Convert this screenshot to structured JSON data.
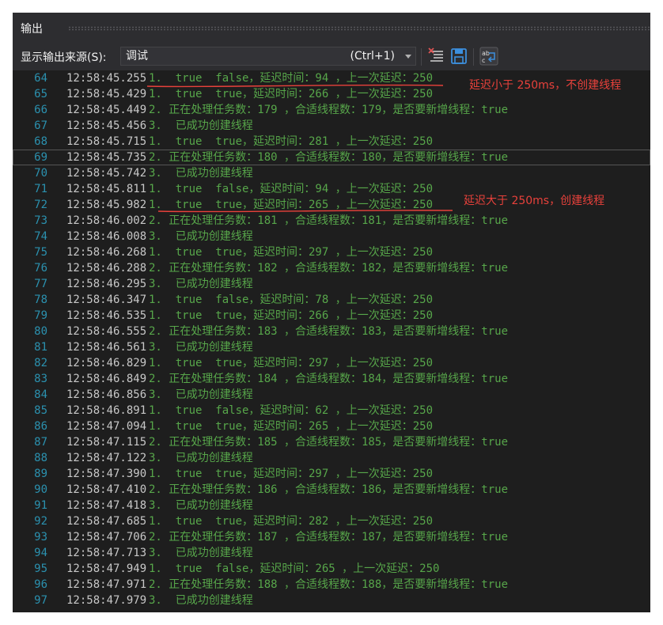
{
  "window": {
    "title": "输出",
    "toolbar": {
      "source_label": "显示输出来源(S):",
      "source_value": "调试",
      "source_hint": "(Ctrl+1)"
    }
  },
  "rows": [
    {
      "ln": "64",
      "ts": "12:58:45.255",
      "msg": "1.  true  false，延迟时间：94 ，上一次延迟：250"
    },
    {
      "ln": "65",
      "ts": "12:58:45.429",
      "msg": "1.  true  true，延迟时间：266 ，上一次延迟：250"
    },
    {
      "ln": "66",
      "ts": "12:58:45.449",
      "msg": "2. 正在处理任务数：179 ，合适线程数：179，是否要新增线程：true"
    },
    {
      "ln": "67",
      "ts": "12:58:45.456",
      "msg": "3.  已成功创建线程"
    },
    {
      "ln": "68",
      "ts": "12:58:45.715",
      "msg": "1.  true  true，延迟时间：281 ，上一次延迟：250"
    },
    {
      "ln": "69",
      "ts": "12:58:45.735",
      "msg": "2. 正在处理任务数：180 ，合适线程数：180，是否要新增线程：true"
    },
    {
      "ln": "70",
      "ts": "12:58:45.742",
      "msg": "3.  已成功创建线程"
    },
    {
      "ln": "71",
      "ts": "12:58:45.811",
      "msg": "1.  true  false，延迟时间：94 ，上一次延迟：250"
    },
    {
      "ln": "72",
      "ts": "12:58:45.982",
      "msg": "1.  true  true，延迟时间：265 ，上一次延迟：250"
    },
    {
      "ln": "73",
      "ts": "12:58:46.002",
      "msg": "2. 正在处理任务数：181 ，合适线程数：181，是否要新增线程：true"
    },
    {
      "ln": "74",
      "ts": "12:58:46.008",
      "msg": "3.  已成功创建线程"
    },
    {
      "ln": "75",
      "ts": "12:58:46.268",
      "msg": "1.  true  true，延迟时间：297 ，上一次延迟：250"
    },
    {
      "ln": "76",
      "ts": "12:58:46.288",
      "msg": "2. 正在处理任务数：182 ，合适线程数：182，是否要新增线程：true"
    },
    {
      "ln": "77",
      "ts": "12:58:46.295",
      "msg": "3.  已成功创建线程"
    },
    {
      "ln": "78",
      "ts": "12:58:46.347",
      "msg": "1.  true  false，延迟时间：78 ，上一次延迟：250"
    },
    {
      "ln": "79",
      "ts": "12:58:46.535",
      "msg": "1.  true  true，延迟时间：266 ，上一次延迟：250"
    },
    {
      "ln": "80",
      "ts": "12:58:46.555",
      "msg": "2. 正在处理任务数：183 ，合适线程数：183，是否要新增线程：true"
    },
    {
      "ln": "81",
      "ts": "12:58:46.561",
      "msg": "3.  已成功创建线程"
    },
    {
      "ln": "82",
      "ts": "12:58:46.829",
      "msg": "1.  true  true，延迟时间：297 ，上一次延迟：250"
    },
    {
      "ln": "83",
      "ts": "12:58:46.849",
      "msg": "2. 正在处理任务数：184 ，合适线程数：184，是否要新增线程：true"
    },
    {
      "ln": "84",
      "ts": "12:58:46.856",
      "msg": "3.  已成功创建线程"
    },
    {
      "ln": "85",
      "ts": "12:58:46.891",
      "msg": "1.  true  false，延迟时间：62 ，上一次延迟：250"
    },
    {
      "ln": "86",
      "ts": "12:58:47.094",
      "msg": "1.  true  true，延迟时间：265 ，上一次延迟：250"
    },
    {
      "ln": "87",
      "ts": "12:58:47.115",
      "msg": "2. 正在处理任务数：185 ，合适线程数：185，是否要新增线程：true"
    },
    {
      "ln": "88",
      "ts": "12:58:47.122",
      "msg": "3.  已成功创建线程"
    },
    {
      "ln": "89",
      "ts": "12:58:47.390",
      "msg": "1.  true  true，延迟时间：297 ，上一次延迟：250"
    },
    {
      "ln": "90",
      "ts": "12:58:47.410",
      "msg": "2. 正在处理任务数：186 ，合适线程数：186，是否要新增线程：true"
    },
    {
      "ln": "91",
      "ts": "12:58:47.418",
      "msg": "3.  已成功创建线程"
    },
    {
      "ln": "92",
      "ts": "12:58:47.685",
      "msg": "1.  true  true，延迟时间：282 ，上一次延迟：250"
    },
    {
      "ln": "93",
      "ts": "12:58:47.706",
      "msg": "2. 正在处理任务数：187 ，合适线程数：187，是否要新增线程：true"
    },
    {
      "ln": "94",
      "ts": "12:58:47.713",
      "msg": "3.  已成功创建线程"
    },
    {
      "ln": "95",
      "ts": "12:58:47.949",
      "msg": "1.  true  false，延迟时间：265 ，上一次延迟：250"
    },
    {
      "ln": "96",
      "ts": "12:58:47.971",
      "msg": "2. 正在处理任务数：188 ，合适线程数：188，是否要新增线程：true"
    },
    {
      "ln": "97",
      "ts": "12:58:47.979",
      "msg": "3.  已成功创建线程"
    }
  ],
  "annotations": {
    "no_create": "延迟小于 250ms，不创建线程",
    "create": "延迟大于 250ms，创建线程"
  },
  "icons": {
    "clear": "clear-all-icon",
    "save": "save-icon",
    "wrap": "word-wrap-icon"
  },
  "colors": {
    "line_number": "#2b91af",
    "timestamp": "#c8c8c8",
    "message": "#57a64a",
    "annotation": "#e8413b"
  }
}
